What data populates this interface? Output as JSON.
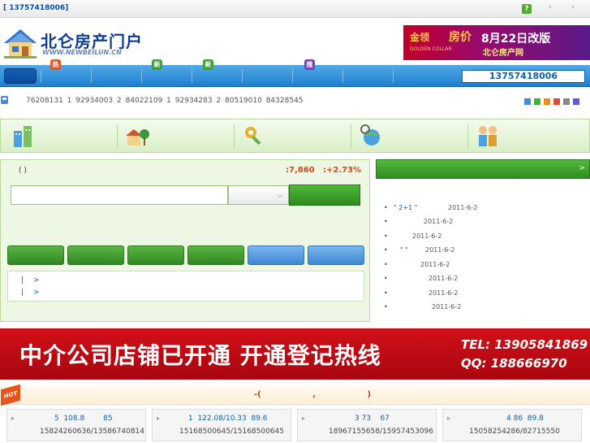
{
  "topbar": {
    "phone_text": "[                 13757418006]",
    "help_label": "?",
    "arrows": [
      "›",
      "›"
    ]
  },
  "header": {
    "logo_title": "北仑房产门户",
    "logo_url": "WWW.NEWBEILUN.CN"
  },
  "ad_top": {
    "brand": "金领",
    "price": "房价",
    "date": "8月22日改版",
    "site": "北仑房产网",
    "small": "GOLDEN COLLAR"
  },
  "nav": {
    "phone": "13757418006",
    "badges": [
      {
        "label": "热",
        "color": "#e8531c"
      },
      {
        "label": "新",
        "color": "#3aa32a"
      },
      {
        "label": "新",
        "color": "#3aa32a"
      },
      {
        "label": "推",
        "color": "#7a3fc0"
      }
    ]
  },
  "hotline": "76208131   1 92934003 2 84022109   1 92934283 2 80519010      84328545",
  "color_squares": [
    "#3b8de0",
    "#41b23a",
    "#f08a1e",
    "#e34a3a",
    "#888888",
    "#5b5bd6"
  ],
  "search": {
    "title": "(      )",
    "index_value": ":7,860",
    "index_change": ":+2.73%",
    "input_value": "",
    "input_placeholder": "",
    "select_chevron": "⌵",
    "links": [
      {
        "bar": "|",
        "arrow": ">"
      },
      {
        "bar": "|",
        "arrow": ">"
      }
    ]
  },
  "news": {
    "more": ">",
    "items": [
      {
        "title": "\"      2+1  \"",
        "date": "2011-6-2"
      },
      {
        "title": "",
        "date": "2011-6-2"
      },
      {
        "title": "",
        "date": "2011-6-2"
      },
      {
        "title": "\"  \"",
        "date": "2011-6-2"
      },
      {
        "title": "",
        "date": "2011-6-2"
      },
      {
        "title": "",
        "date": "2011-6-2"
      },
      {
        "title": "",
        "date": "2011-6-2"
      },
      {
        "title": "",
        "date": "2011-6-2"
      }
    ]
  },
  "banner": {
    "text": "中介公司店铺已开通  开通登记热线",
    "tel": "TEL: 13905841869",
    "qq": "QQ:   188666970"
  },
  "agencies": {
    "hot_label": "HOT",
    "title": "-(           ,           )",
    "cards": [
      {
        "r1": "5  108.8        85",
        "r2": "15824260636/13586740814"
      },
      {
        "r1": "1  122.08/10.33  89.6",
        "r2": "15168500645/15168500645"
      },
      {
        "r1": "3 73    67",
        "r2": "18967155658/15957453096"
      },
      {
        "r1": "4 86  89.8",
        "r2": "15058254286/82715550"
      }
    ]
  }
}
